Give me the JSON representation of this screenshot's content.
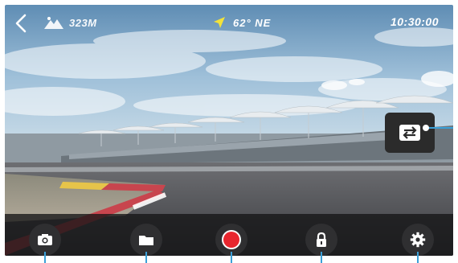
{
  "status_bar": {
    "altitude": "323M",
    "heading": "62° NE",
    "time": "10:30:00"
  },
  "colors": {
    "callout_line": "#3aa0d8",
    "record_red": "#e8262e",
    "button_bg": "#2f2f31",
    "gps_arrow": "#f2e23a"
  },
  "icons": {
    "back": "chevron-left-icon",
    "altitude": "mountain-icon",
    "heading": "gps-arrow-icon",
    "switch": "swap-icon",
    "photo": "camera-icon",
    "album": "folder-icon",
    "record": "record-icon",
    "lock": "lock-icon",
    "settings": "gear-icon"
  }
}
